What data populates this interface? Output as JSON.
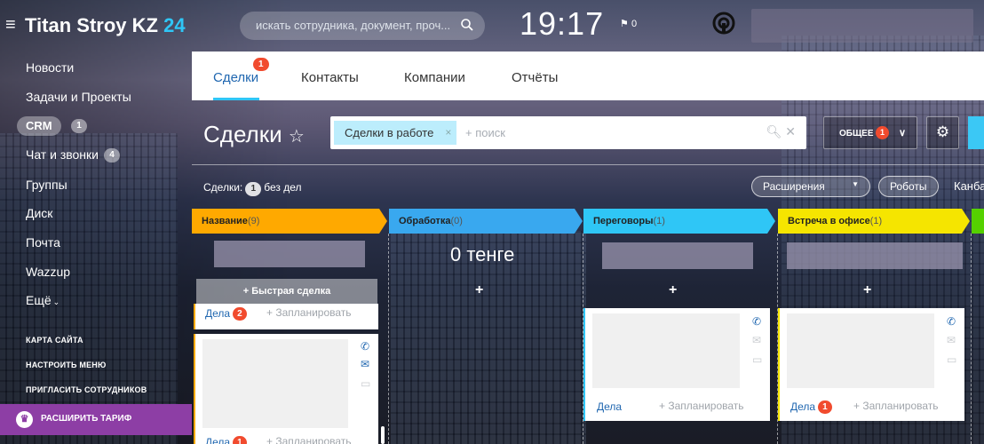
{
  "header": {
    "menu_icon": "hamburger-icon",
    "logo_text": "Titan Stroy KZ",
    "logo_suffix": "24",
    "search_placeholder": "искать сотрудника, документ, проч...",
    "clock": "19:17",
    "flag_count": "0"
  },
  "sidebar": {
    "items": [
      {
        "label": "Новости"
      },
      {
        "label": "Задачи и Проекты"
      },
      {
        "label": "CRM",
        "count": "1"
      },
      {
        "label": "Чат и звонки",
        "count": "4"
      },
      {
        "label": "Группы"
      },
      {
        "label": "Диск"
      },
      {
        "label": "Почта"
      },
      {
        "label": "Wazzup"
      },
      {
        "label": "Ещё"
      }
    ],
    "links": [
      "КАРТА САЙТА",
      "НАСТРОИТЬ МЕНЮ",
      "ПРИГЛАСИТЬ СОТРУДНИКОВ"
    ],
    "upgrade_label": "РАСШИРИТЬ ТАРИФ"
  },
  "tabs": {
    "items": [
      "Сделки",
      "Контакты",
      "Компании",
      "Отчёты"
    ],
    "active_badge": "1"
  },
  "toolbar": {
    "title": "Сделки",
    "filter_chip": "Сделки в работе",
    "filter_placeholder": "+ поиск",
    "preset_label": "ОБЩЕЕ",
    "preset_badge": "1"
  },
  "summary": {
    "prefix": "Сделки:",
    "count": "1",
    "suffix": "без дел",
    "extensions_label": "Расширения",
    "robots_label": "Роботы",
    "kanban_label": "Канба"
  },
  "stages": [
    {
      "name": "Название",
      "count": "(9)",
      "color": "#ffa900"
    },
    {
      "name": "Обработка",
      "count": "(0)",
      "color": "#39a8ef"
    },
    {
      "name": "Переговоры",
      "count": "(1)",
      "color": "#2fc6f6"
    },
    {
      "name": "Встреча в офисе",
      "count": "(1)",
      "color": "#f5e500"
    },
    {
      "name": "",
      "count": "",
      "color": "#55d100"
    }
  ],
  "board": {
    "zero_sum": "0 тенге",
    "quick_deal": "Быстрая сделка",
    "deals_label": "Дела",
    "plan_label": "+ Запланировать",
    "badges": [
      "2",
      "1",
      "1"
    ]
  }
}
